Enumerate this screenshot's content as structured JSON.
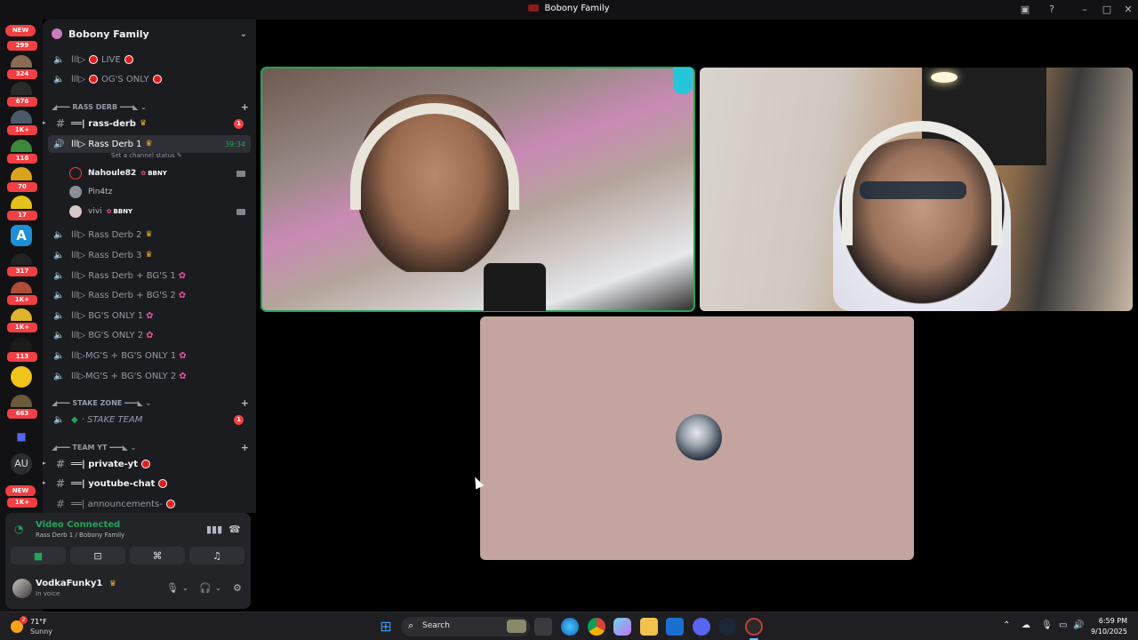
{
  "window": {
    "title": "Bobony Family"
  },
  "rail": {
    "top_pill": "NEW",
    "bottom_pill": "NEW",
    "au_label": "AU",
    "badges": [
      "299",
      "324",
      "676",
      "1K+",
      "118",
      "70",
      "17",
      "317",
      "1K+",
      "1K+",
      "113",
      "663",
      "1K+"
    ]
  },
  "guild": {
    "name": "Bobony Family"
  },
  "channels": {
    "live": "LIVE",
    "ogs_only": "OG'S ONLY",
    "cat_rass_derb": "RASS DERB",
    "rass_derb_text": "rass-derb",
    "rass_derb_unread": "1",
    "rass_derb_1": "Rass Derb 1",
    "rass_derb_1_time": "39:34",
    "rass_derb_1_status": "Set a channel status",
    "members": [
      {
        "name": "Nahoule82",
        "tag": "BBNY"
      },
      {
        "name": "Pin4tz",
        "tag": ""
      },
      {
        "name": "vivi",
        "tag": "BBNY"
      }
    ],
    "rass_derb_2": "Rass Derb 2",
    "rass_derb_3": "Rass Derb 3",
    "rass_derb_bgs_1": "Rass Derb + BG'S 1",
    "rass_derb_bgs_2": "Rass Derb + BG'S 2",
    "bgs_only_1": "BG'S ONLY 1",
    "bgs_only_2": "BG'S ONLY 2",
    "mgs_bgs_only_1": "MG'S + BG'S ONLY 1",
    "mgs_bgs_only_2": "MG'S + BG'S ONLY 2",
    "cat_stake_zone": "STAKE ZONE",
    "stake_team": "STAKE TEAM",
    "stake_unread": "1",
    "cat_team_yt": "TEAM YT",
    "private_yt": "private-yt",
    "youtube_chat": "youtube-chat",
    "announcements": "announcements-"
  },
  "voice": {
    "status": "Video Connected",
    "location": "Rass Derb 1 / Bobony Family"
  },
  "user": {
    "name": "VodkaFunky1",
    "status": "In voice"
  },
  "taskbar": {
    "weather_temp": "71°F",
    "weather_cond": "Sunny",
    "weather_badge": "2",
    "search_label": "Search",
    "time": "6:59 PM",
    "date": "9/10/2025"
  },
  "colors": {
    "accent_green": "#23a55a",
    "badge_red": "#f23f43",
    "avatar_tile_bg": "#c4a49e"
  }
}
